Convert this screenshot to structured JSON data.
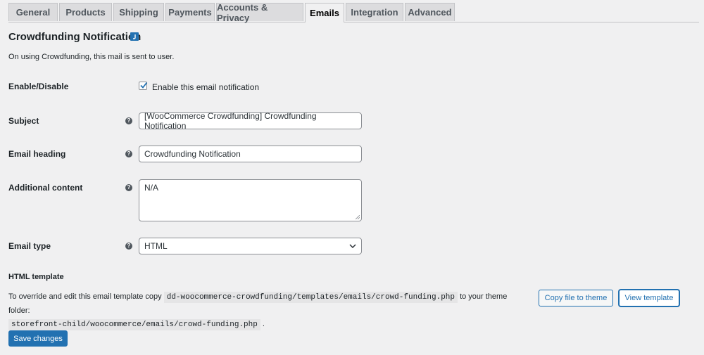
{
  "tabs": [
    {
      "label": "General",
      "active": false
    },
    {
      "label": "Products",
      "active": false
    },
    {
      "label": "Shipping",
      "active": false
    },
    {
      "label": "Payments",
      "active": false
    },
    {
      "label": "Accounts & Privacy",
      "active": false
    },
    {
      "label": "Emails",
      "active": true
    },
    {
      "label": "Integration",
      "active": false
    },
    {
      "label": "Advanced",
      "active": false
    }
  ],
  "page": {
    "title": "Crowdfunding Notification",
    "description": "On using Crowdfunding, this mail is sent to user."
  },
  "fields": {
    "enable": {
      "label": "Enable/Disable",
      "checkbox_label": "Enable this email notification",
      "checked": true
    },
    "subject": {
      "label": "Subject",
      "value": "[WooCommerce Crowdfunding] Crowdfunding Notification"
    },
    "heading": {
      "label": "Email heading",
      "value": "Crowdfunding Notification"
    },
    "additional": {
      "label": "Additional content",
      "value": "N/A"
    },
    "email_type": {
      "label": "Email type",
      "value": "HTML"
    }
  },
  "template": {
    "heading": "HTML template",
    "text_before": "To override and edit this email template copy",
    "source_path": "dd-woocommerce-crowdfunding/templates/emails/crowd-funding.php",
    "text_middle": "to your theme folder:",
    "dest_path": "storefront-child/woocommerce/emails/crowd-funding.php",
    "text_after": ".",
    "copy_button": "Copy file to theme",
    "view_button": "View template"
  },
  "save_button": "Save changes",
  "colors": {
    "primary": "#2271b1",
    "background": "#f0f0f1",
    "tab": "#dcdcde"
  }
}
